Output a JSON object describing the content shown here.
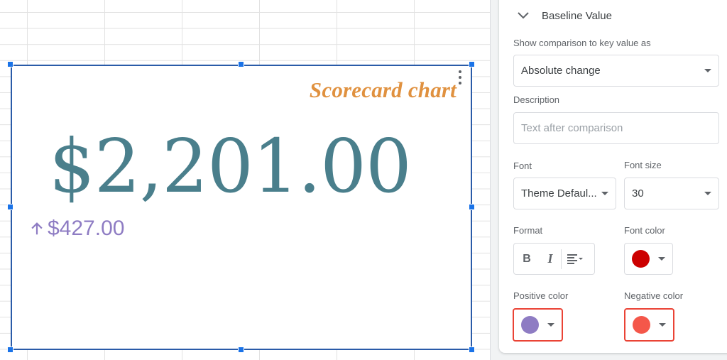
{
  "chart": {
    "title": "Scorecard chart",
    "key_value": "$2,201.00",
    "baseline_change": "$427.00",
    "baseline_direction": "up",
    "key_value_color": "#4a7f8c",
    "title_color": "#e0913f",
    "change_color": "#8e7cc3"
  },
  "panel": {
    "section_title": "Baseline Value",
    "comparison_label": "Show comparison to key value as",
    "comparison_value": "Absolute change",
    "description_label": "Description",
    "description_placeholder": "Text after comparison",
    "description_value": "",
    "font_label": "Font",
    "font_value": "Theme Defaul...",
    "font_size_label": "Font size",
    "font_size_value": "30",
    "format_label": "Format",
    "format_bold": "B",
    "format_italic": "I",
    "font_color_label": "Font color",
    "font_color": "#cc0000",
    "positive_color_label": "Positive color",
    "positive_color": "#8e7cc3",
    "negative_color_label": "Negative color",
    "negative_color": "#f4574a"
  }
}
